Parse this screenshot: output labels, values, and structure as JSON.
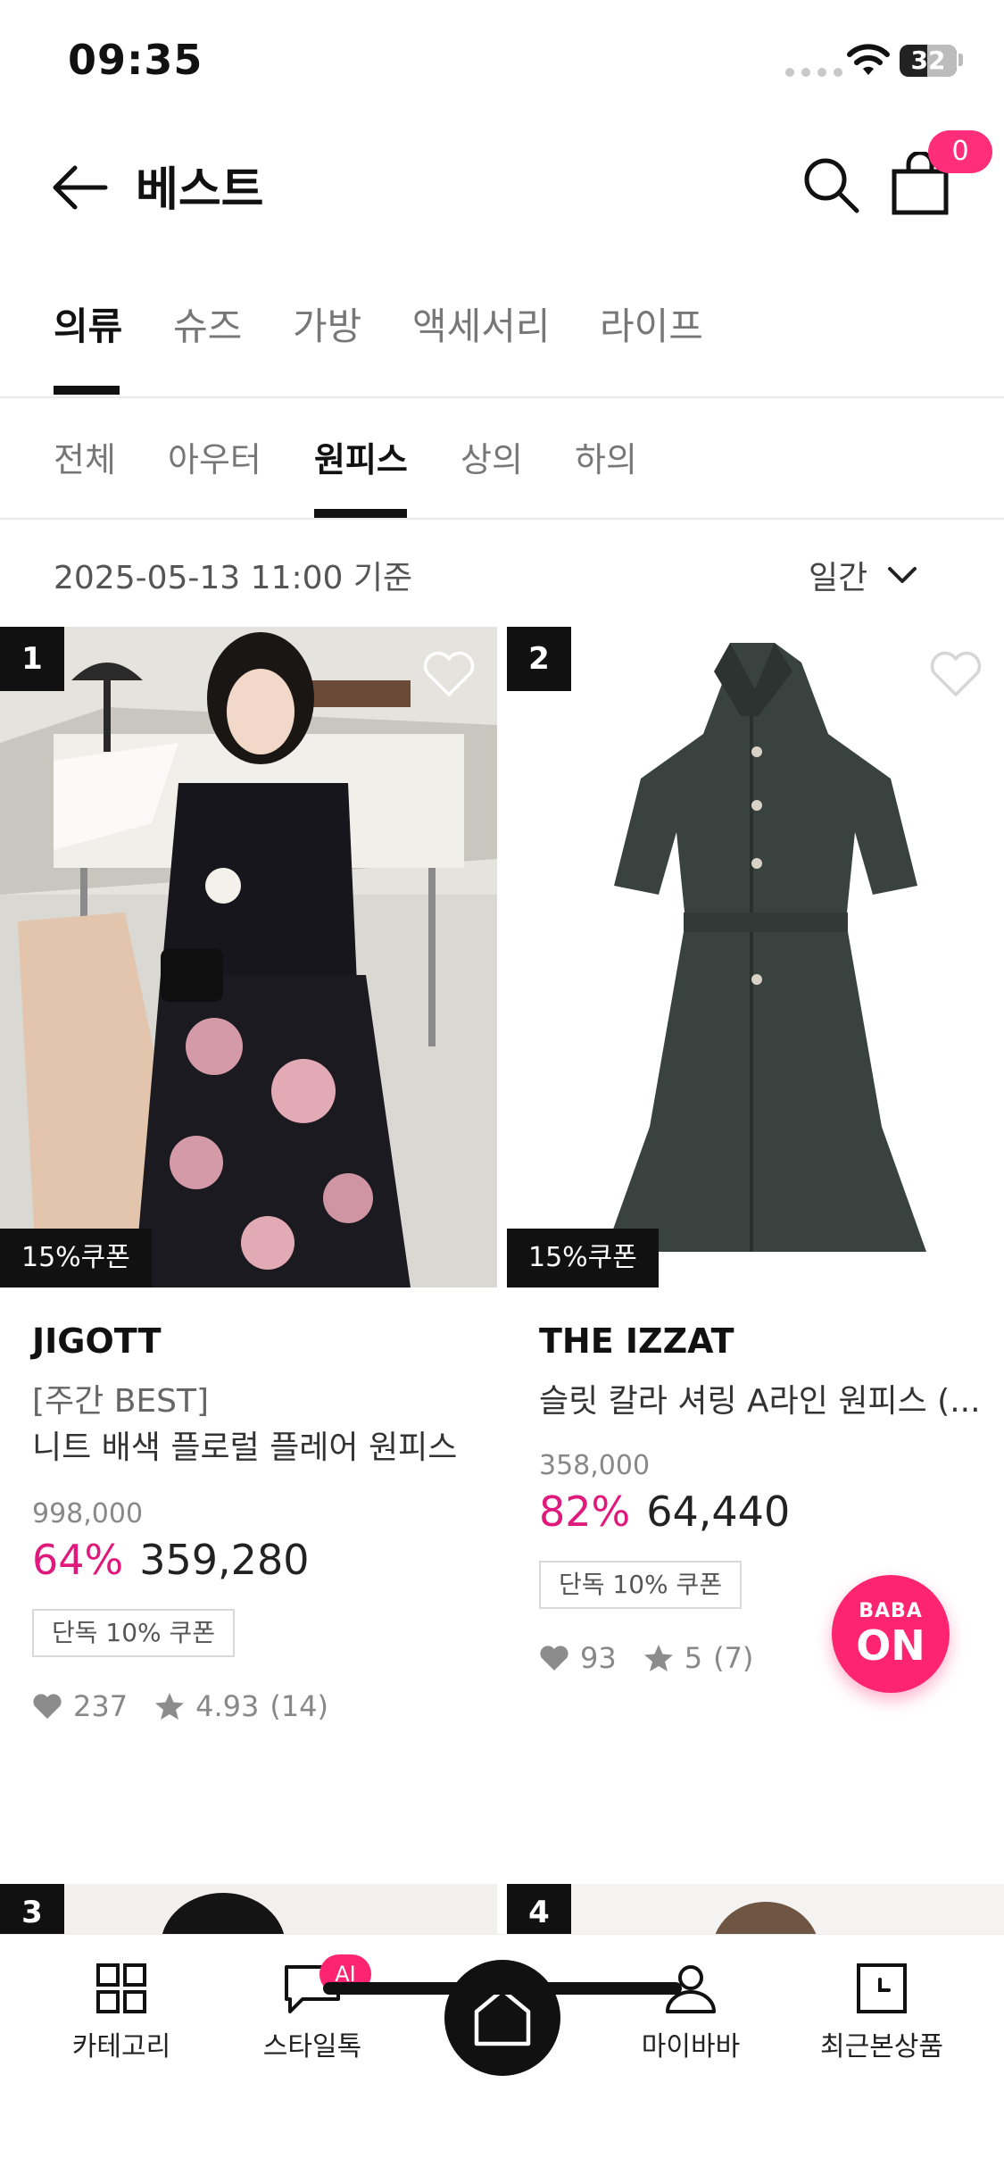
{
  "status_bar": {
    "time": "09:35",
    "battery": "32"
  },
  "header": {
    "title": "베스트",
    "cart_count": "0"
  },
  "main_tabs": [
    "의류",
    "슈즈",
    "가방",
    "액세서리",
    "라이프"
  ],
  "sub_tabs": [
    "전체",
    "아우터",
    "원피스",
    "상의",
    "하의"
  ],
  "date_basis": "2025-05-13 11:00 기준",
  "period": "일간",
  "products": [
    {
      "rank": "1",
      "coupon_tag": "15%쿠폰",
      "brand": "JIGOTT",
      "name_line1": "[주간 BEST]",
      "name_line2": "니트 배색 플로럴 플레어 원피스",
      "original_price": "998,000",
      "discount": "64%",
      "price": "359,280",
      "exclusive_coupon": "단독 10% 쿠폰",
      "likes": "237",
      "rating": "4.93",
      "reviews": "(14)"
    },
    {
      "rank": "2",
      "coupon_tag": "15%쿠폰",
      "brand": "THE IZZAT",
      "name_line1": "슬릿 칼라 셔링 A라인 원피스 (...",
      "original_price": "358,000",
      "discount": "82%",
      "price": "64,440",
      "exclusive_coupon": "단독 10% 쿠폰",
      "likes": "93",
      "rating": "5",
      "reviews": "(7)"
    }
  ],
  "next_ranks": [
    "3",
    "4"
  ],
  "fab": {
    "line1": "BABA",
    "line2": "ON"
  },
  "bottom_nav": {
    "category": "카테고리",
    "styletalk": "스타일톡",
    "styletalk_badge": "AI",
    "mybaba": "마이바바",
    "recent": "최근본상품"
  },
  "colors": {
    "accent": "#ff2d7a",
    "discount": "#e0197d"
  }
}
